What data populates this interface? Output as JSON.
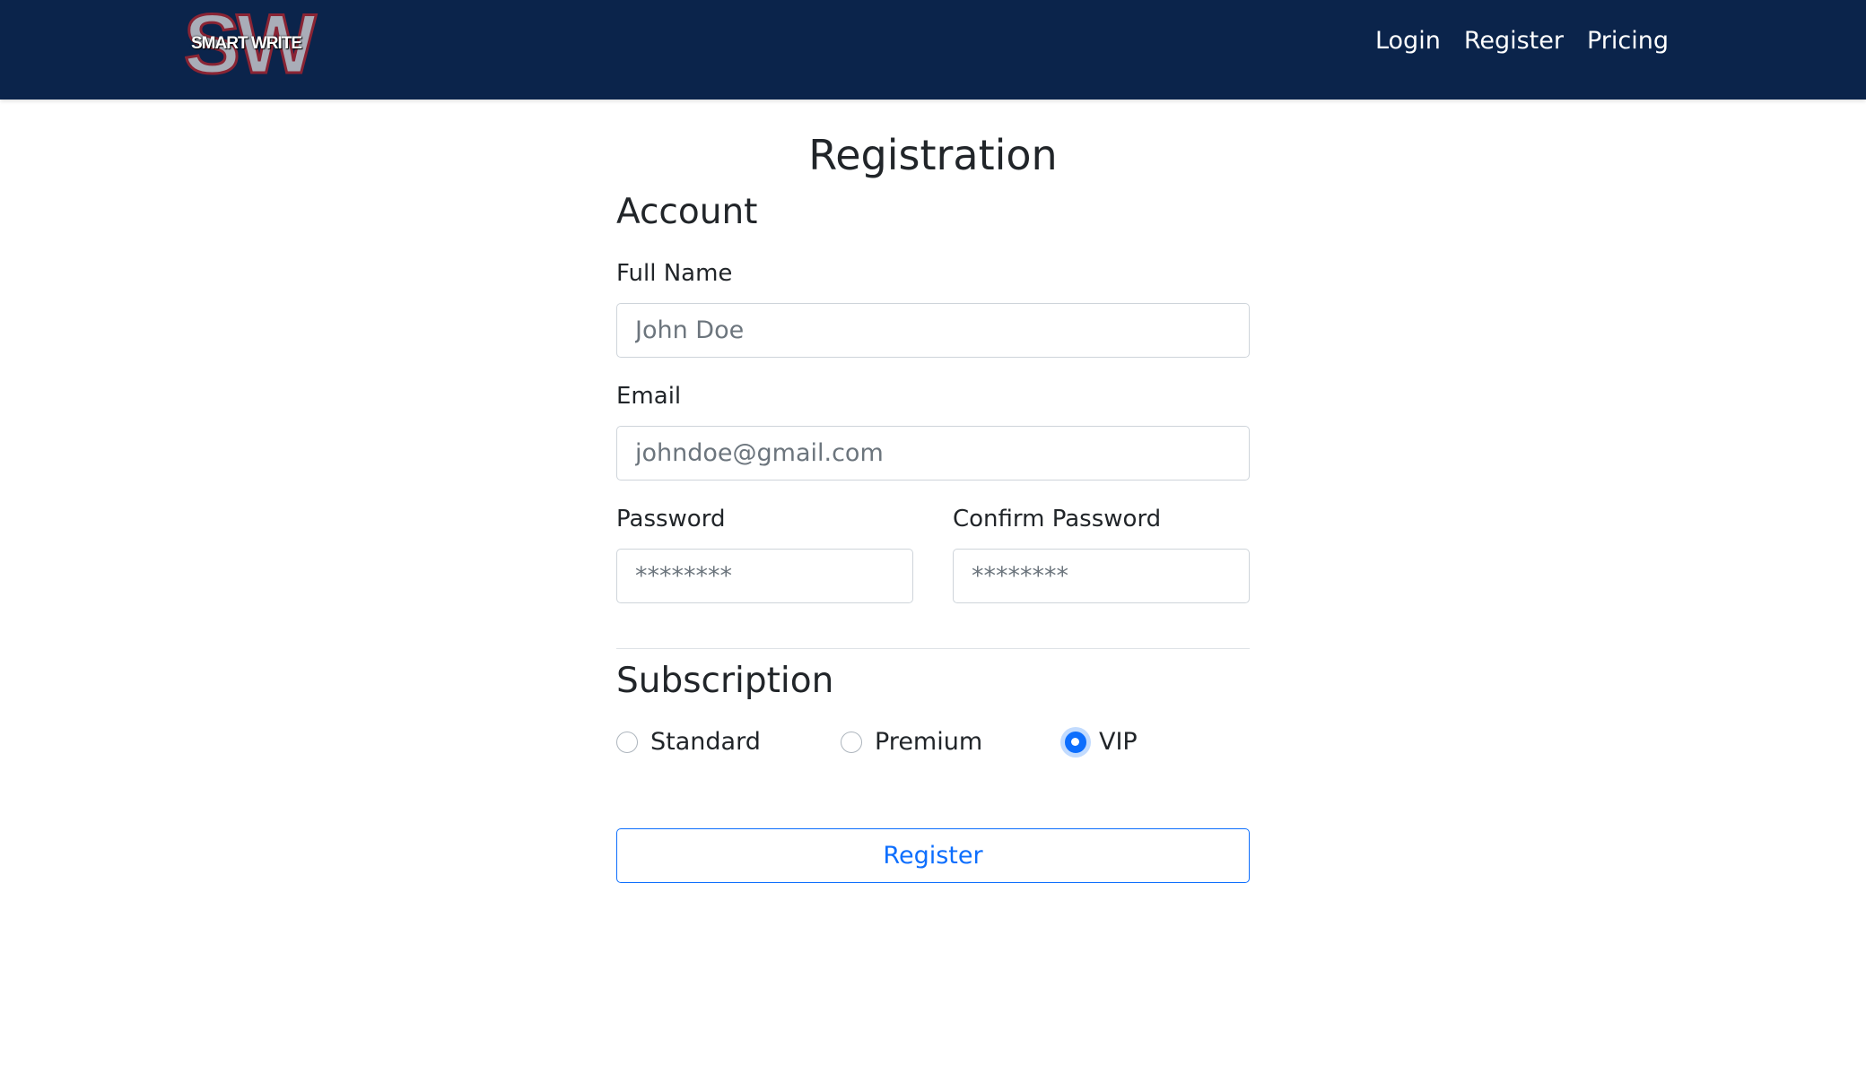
{
  "brand": {
    "logo_big": "SW",
    "logo_small": "SMART WRITE",
    "navbar_color": "#0b244b"
  },
  "nav": {
    "items": [
      {
        "label": "Login"
      },
      {
        "label": "Register"
      },
      {
        "label": "Pricing"
      }
    ]
  },
  "page": {
    "title": "Registration"
  },
  "account": {
    "heading": "Account",
    "full_name": {
      "label": "Full Name",
      "placeholder": "John Doe",
      "value": ""
    },
    "email": {
      "label": "Email",
      "placeholder": "johndoe@gmail.com",
      "value": ""
    },
    "password": {
      "label": "Password",
      "placeholder": "********",
      "value": ""
    },
    "confirm_password": {
      "label": "Confirm Password",
      "placeholder": "********",
      "value": ""
    }
  },
  "subscription": {
    "heading": "Subscription",
    "options": [
      {
        "label": "Standard",
        "checked": false
      },
      {
        "label": "Premium",
        "checked": false
      },
      {
        "label": "VIP",
        "checked": true
      }
    ]
  },
  "actions": {
    "register_label": "Register",
    "accent_color": "#0d6efd"
  }
}
